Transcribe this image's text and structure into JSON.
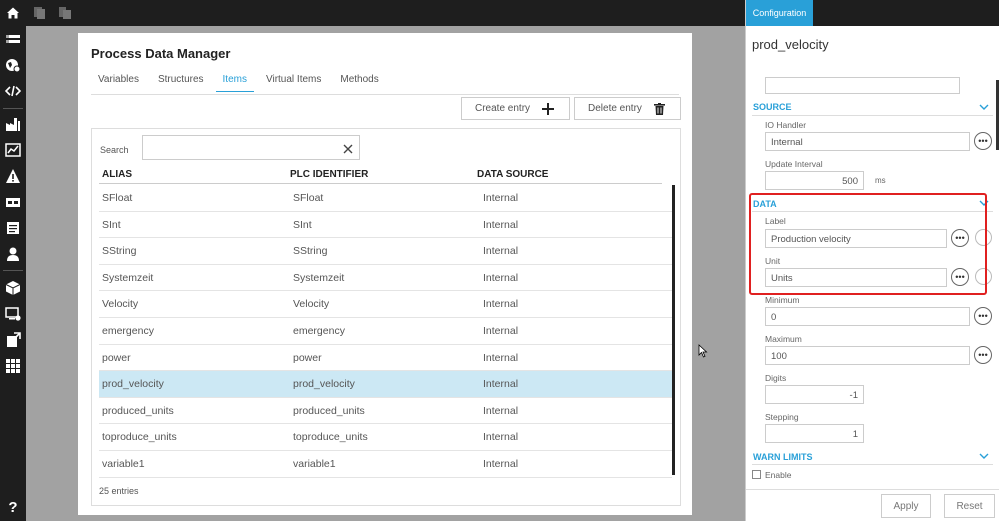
{
  "card": {
    "title": "Process Data Manager",
    "tabs": [
      "Variables",
      "Structures",
      "Items",
      "Virtual Items",
      "Methods"
    ],
    "active_tab": "Items",
    "create_label": "Create entry",
    "delete_label": "Delete entry"
  },
  "table": {
    "search_label": "Search",
    "search_value": "",
    "columns": [
      "ALIAS",
      "PLC IDENTIFIER",
      "DATA SOURCE"
    ],
    "rows": [
      [
        "SFloat",
        "SFloat",
        "Internal"
      ],
      [
        "SInt",
        "SInt",
        "Internal"
      ],
      [
        "SString",
        "SString",
        "Internal"
      ],
      [
        "Systemzeit",
        "Systemzeit",
        "Internal"
      ],
      [
        "Velocity",
        "Velocity",
        "Internal"
      ],
      [
        "emergency",
        "emergency",
        "Internal"
      ],
      [
        "power",
        "power",
        "Internal"
      ],
      [
        "prod_velocity",
        "prod_velocity",
        "Internal"
      ],
      [
        "produced_units",
        "produced_units",
        "Internal"
      ],
      [
        "toproduce_units",
        "toproduce_units",
        "Internal"
      ],
      [
        "variable1",
        "variable1",
        "Internal"
      ]
    ],
    "selected_row": 7,
    "count": "25 entries"
  },
  "panel": {
    "tab": "Configuration",
    "title": "prod_velocity",
    "sections": {
      "source": "SOURCE",
      "data": "DATA",
      "warn": "WARN LIMITS"
    },
    "io_handler_label": "IO Handler",
    "io_handler_value": "Internal",
    "update_interval_label": "Update Interval",
    "update_interval_value": "500",
    "update_interval_unit": "ms",
    "label_label": "Label",
    "label_value": "Production velocity",
    "unit_label": "Unit",
    "unit_value": "Units",
    "minimum_label": "Minimum",
    "minimum_value": "0",
    "maximum_label": "Maximum",
    "maximum_value": "100",
    "digits_label": "Digits",
    "digits_value": "-1",
    "stepping_label": "Stepping",
    "stepping_value": "1",
    "enable_label": "Enable",
    "apply_label": "Apply",
    "reset_label": "Reset"
  },
  "colors": {
    "accent": "#29a0d8",
    "dark": "#1e1e1e",
    "selected_row": "#cce8f4",
    "highlight": "#e02020"
  }
}
